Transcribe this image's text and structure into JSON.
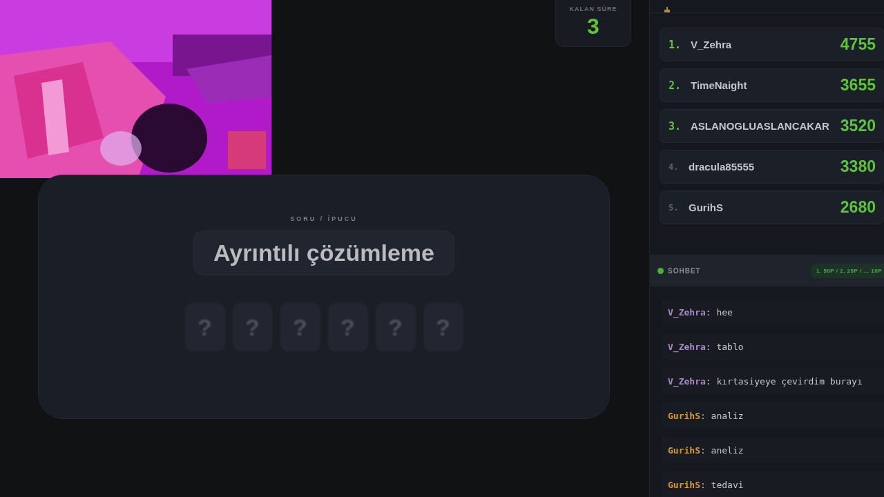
{
  "timer": {
    "label": "KALAN SÜRE",
    "value": "3"
  },
  "question": {
    "label": "SORU / İPUCU",
    "clue": "Ayrıntılı çözümleme",
    "letters": [
      "?",
      "?",
      "?",
      "?",
      "?",
      "?"
    ]
  },
  "leaderboard": {
    "rows": [
      {
        "rank": "1.",
        "name": "V_Zehra",
        "score": "4755",
        "top": true
      },
      {
        "rank": "2.",
        "name": "TimeNaight",
        "score": "3655",
        "top": true
      },
      {
        "rank": "3.",
        "name": "ASLANOGLUASLANCAKAR",
        "score": "3520",
        "top": true
      },
      {
        "rank": "4.",
        "name": "dracula85555",
        "score": "3380",
        "top": false
      },
      {
        "rank": "5.",
        "name": "GurihS",
        "score": "2680",
        "top": false
      }
    ]
  },
  "chat": {
    "title": "SOHBET",
    "online": true,
    "points": "1. 50P / 2. 25P / ... 10P",
    "messages": [
      {
        "user": "V_Zehra",
        "text": ": hee",
        "color": "#a98bc4"
      },
      {
        "user": "V_Zehra",
        "text": ": tablo",
        "color": "#a98bc4"
      },
      {
        "user": "V_Zehra",
        "text": ": kırtasiyeye çevirdim burayı",
        "color": "#a98bc4"
      },
      {
        "user": "GurihS",
        "text": ": analiz",
        "color": "#d99a3a"
      },
      {
        "user": "GurihS",
        "text": ": aneliz",
        "color": "#d99a3a"
      },
      {
        "user": "GurihS",
        "text": ": tedavi",
        "color": "#d99a3a"
      }
    ]
  }
}
